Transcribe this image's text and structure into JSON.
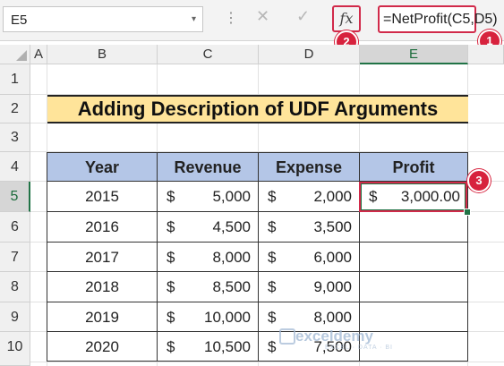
{
  "formula_bar": {
    "name_box": "E5",
    "name_box_arrow": "▾",
    "dots": "⋮",
    "cancel": "✕",
    "enter": "✓",
    "fx": "fx",
    "formula": "=NetProfit(C5,D5)"
  },
  "badges": {
    "one": "1",
    "two": "2",
    "three": "3"
  },
  "columns": [
    "A",
    "B",
    "C",
    "D",
    "E"
  ],
  "rows": [
    "1",
    "2",
    "3",
    "4",
    "5",
    "6",
    "7",
    "8",
    "9",
    "10"
  ],
  "sheet": {
    "title": "Adding Description of UDF Arguments",
    "headers": {
      "year": "Year",
      "revenue": "Revenue",
      "expense": "Expense",
      "profit": "Profit"
    },
    "currency": "$",
    "data": [
      {
        "year": "2015",
        "revenue": "5,000",
        "expense": "2,000",
        "profit": "3,000.00"
      },
      {
        "year": "2016",
        "revenue": "4,500",
        "expense": "3,500",
        "profit": ""
      },
      {
        "year": "2017",
        "revenue": "8,000",
        "expense": "6,000",
        "profit": ""
      },
      {
        "year": "2018",
        "revenue": "8,500",
        "expense": "9,000",
        "profit": ""
      },
      {
        "year": "2019",
        "revenue": "10,000",
        "expense": "8,000",
        "profit": ""
      },
      {
        "year": "2020",
        "revenue": "10,500",
        "expense": "7,500",
        "profit": ""
      }
    ]
  },
  "watermark": {
    "name": "exceldemy",
    "tagline": "EXCEL · DATA · BI"
  },
  "colors": {
    "highlight": "#d12a4a",
    "header_fill": "#b4c6e7",
    "title_fill": "#ffe49a",
    "selection": "#217346"
  }
}
